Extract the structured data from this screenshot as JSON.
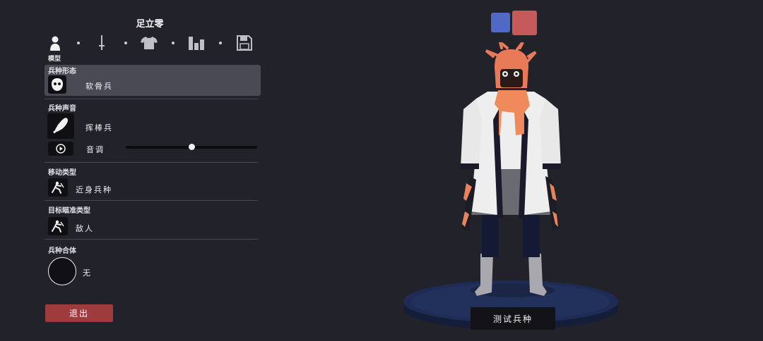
{
  "header": {
    "title": "足立零"
  },
  "tabs": [
    {
      "icon": "person-icon",
      "label": "模型"
    },
    {
      "icon": "sword-icon"
    },
    {
      "icon": "shirt-icon"
    },
    {
      "icon": "bars-icon"
    },
    {
      "icon": "save-icon"
    }
  ],
  "sections": {
    "form": {
      "label": "兵种形态",
      "value": "软骨兵",
      "icon": "skull-icon"
    },
    "voice": {
      "label": "兵种声音",
      "value": "挥棒兵",
      "icon": "club-icon",
      "pitch_label": "音调",
      "pitch_value": 0.5
    },
    "movement": {
      "label": "移动类型",
      "value": "近身兵种",
      "icon": "melee-icon"
    },
    "targeting": {
      "label": "目标瞄准类型",
      "value": "敌人",
      "icon": "target-melee-icon"
    },
    "combine": {
      "label": "兵种合体",
      "value": "无"
    }
  },
  "buttons": {
    "exit": "退出",
    "test_unit": "测试兵种"
  },
  "colors": {
    "team_blue": "#5068c6",
    "team_red": "#c65a5a",
    "exit_button": "#9d3b3d",
    "background": "#22222b"
  }
}
